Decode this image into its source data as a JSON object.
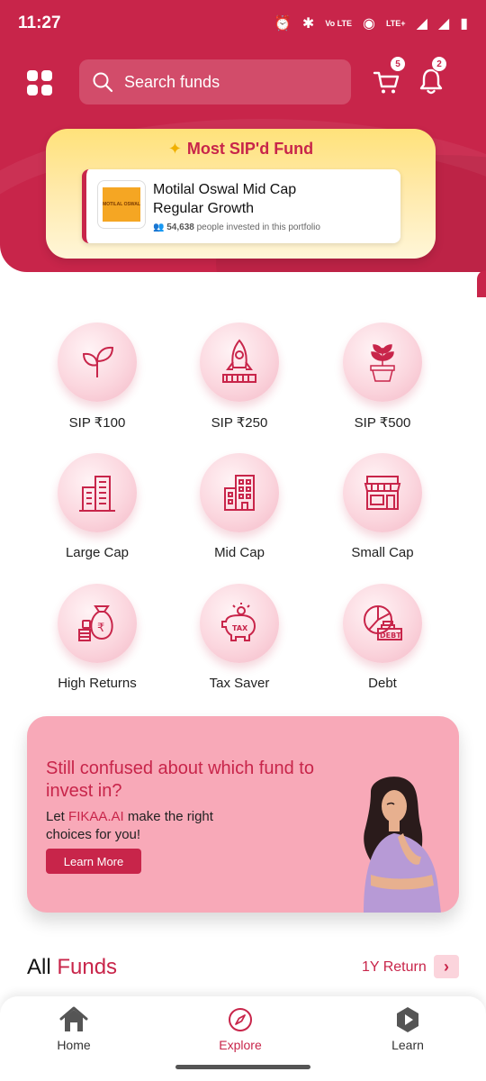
{
  "status": {
    "time": "11:27",
    "volte": "Vo LTE",
    "lte": "LTE+"
  },
  "header": {
    "search_placeholder": "Search funds",
    "cart_count": "5",
    "notification_count": "2"
  },
  "featured": {
    "title": "Most SIP'd Fund",
    "fund_name": "Motilal Oswal Mid Cap Regular Growth",
    "investor_count": "54,638",
    "investor_text": "people invested in this portfolio",
    "logo_text": "MOTILAL OSWAL"
  },
  "categories": [
    {
      "label": "SIP ₹100",
      "icon": "plant-icon"
    },
    {
      "label": "SIP ₹250",
      "icon": "rocket-icon"
    },
    {
      "label": "SIP ₹500",
      "icon": "potted-plant-icon"
    },
    {
      "label": "Large Cap",
      "icon": "skyscraper-icon"
    },
    {
      "label": "Mid Cap",
      "icon": "building-icon"
    },
    {
      "label": "Small Cap",
      "icon": "shop-icon"
    },
    {
      "label": "High Returns",
      "icon": "money-bag-icon"
    },
    {
      "label": "Tax Saver",
      "icon": "piggy-bank-icon"
    },
    {
      "label": "Debt",
      "icon": "debt-chart-icon"
    }
  ],
  "promo": {
    "title": "Still confused about which fund to invest in?",
    "sub_prefix": "Let ",
    "sub_highlight": "FIKAA.AI",
    "sub_suffix": " make the right choices for you!",
    "button": "Learn More"
  },
  "funds_section": {
    "title_plain": "All",
    "title_accent": "Funds",
    "return_label": "1Y Return"
  },
  "nav": [
    {
      "label": "Home",
      "icon": "home-icon",
      "active": false
    },
    {
      "label": "Explore",
      "icon": "compass-icon",
      "active": true
    },
    {
      "label": "Learn",
      "icon": "play-hexagon-icon",
      "active": false
    }
  ],
  "colors": {
    "brand": "#c8254a",
    "gold": "#ffe27a",
    "promo_bg": "#f8a9b8"
  }
}
